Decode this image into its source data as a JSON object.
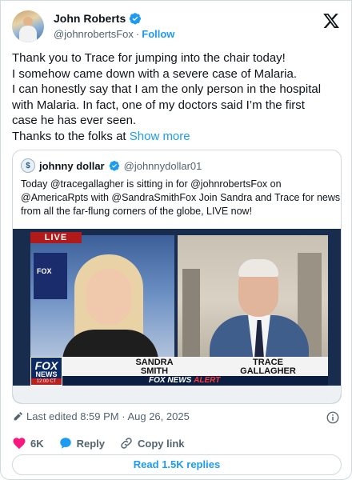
{
  "author": {
    "name": "John Roberts",
    "handle": "@johnrobertsFox",
    "separator": "·",
    "follow_label": "Follow"
  },
  "tweet": {
    "lines": [
      "Thank you to Trace for jumping into the chair today!",
      "I somehow came down with a severe case of Malaria.",
      "I can honestly say that I am the only person in the hospital",
      "with Malaria. In fact, one of my doctors said I’m the first",
      "case he has ever seen.",
      "Thanks to the folks at"
    ],
    "show_more": "Show more"
  },
  "quote": {
    "name": "johnny dollar",
    "handle": "@johnnydollar01",
    "lines": [
      "Today @tracegallagher is sitting in for @johnrobertsFox on",
      "@AmericaRpts with @SandraSmithFox  Join Sandra and Trace for news",
      "from all the far-flung corners of the globe, LIVE now!"
    ],
    "media": {
      "live_label": "LIVE",
      "left_name": [
        "SANDRA",
        "SMITH"
      ],
      "right_name": [
        "TRACE",
        "GALLAGHER"
      ],
      "network_logo": [
        "FOX",
        "NEWS",
        "12:00 CT"
      ],
      "alert_text": "FOX NEWS",
      "alert_word": "ALERT"
    }
  },
  "meta": {
    "edited": "Last edited 8:59 PM · Aug 26, 2025"
  },
  "actions": {
    "likes": "6K",
    "reply": "Reply",
    "copy_link": "Copy link"
  },
  "read_replies": "Read 1.5K replies",
  "colors": {
    "accent": "#1d9bf0",
    "like": "#f91880",
    "text": "#0f1419",
    "muted": "#536471"
  }
}
